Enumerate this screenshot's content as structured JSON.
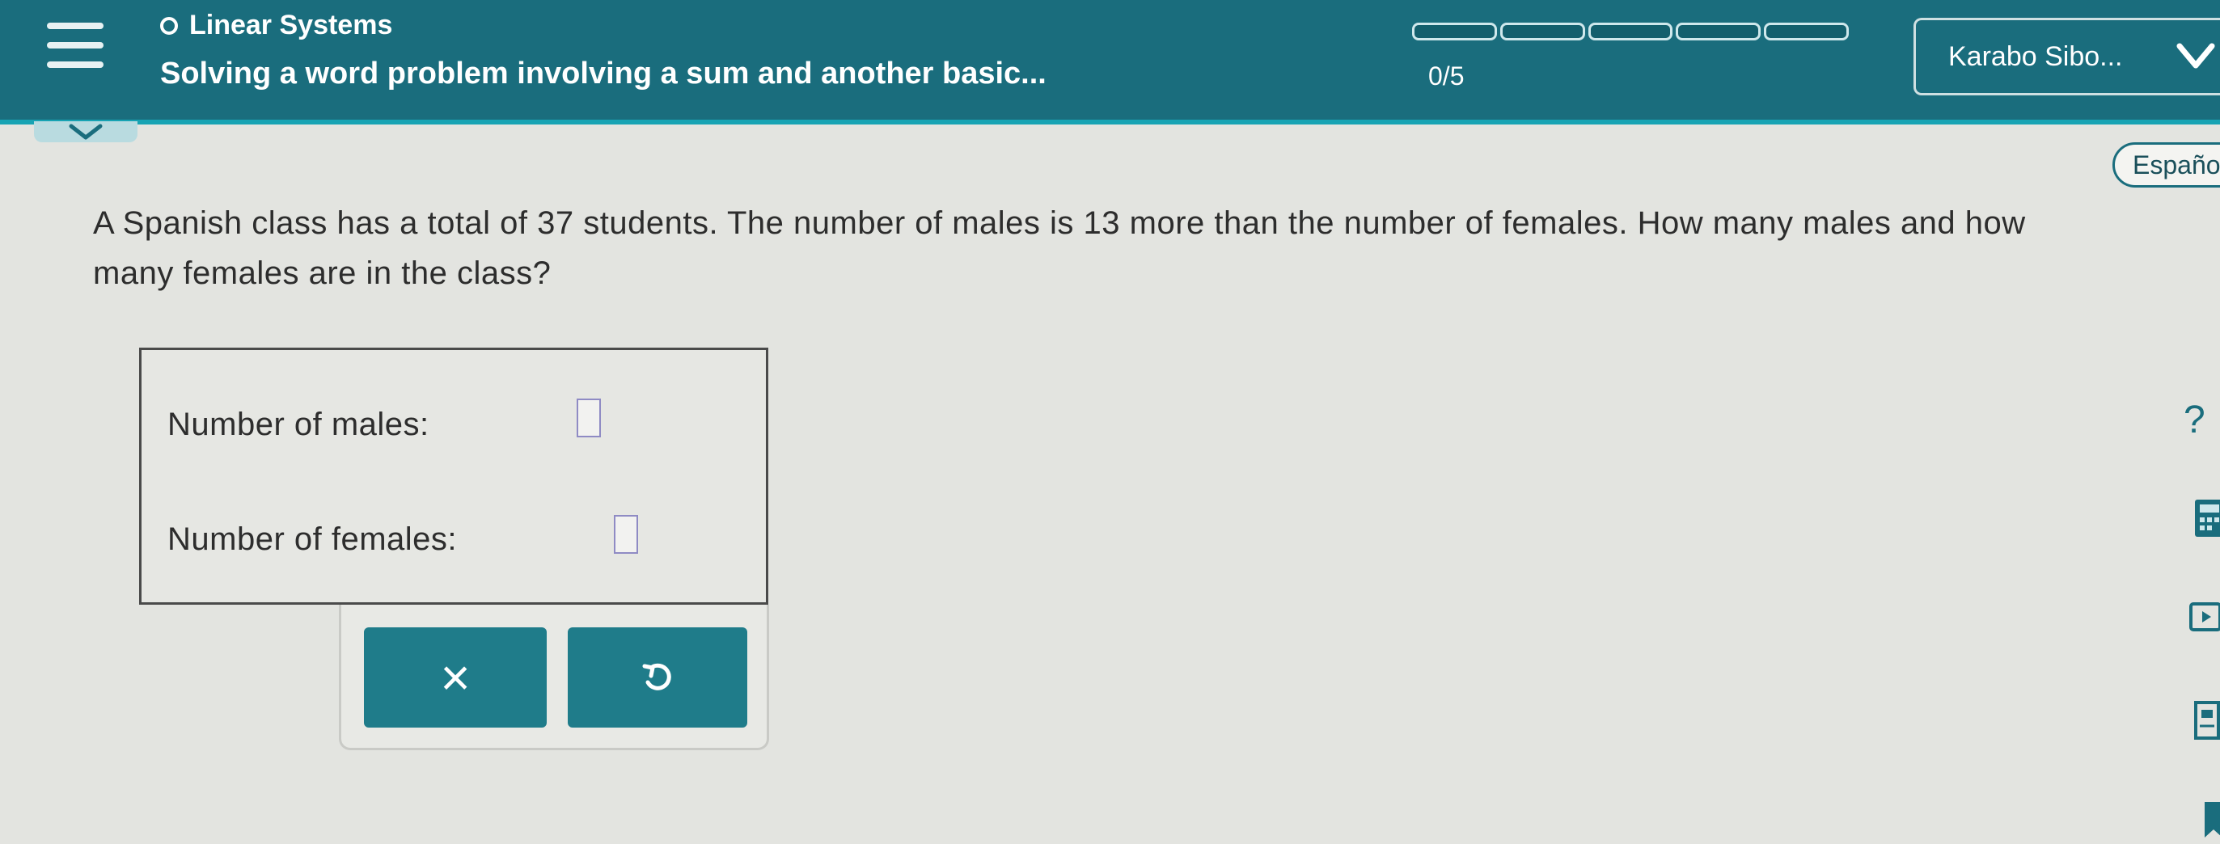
{
  "header": {
    "topic": "Linear Systems",
    "problem_title": "Solving a word problem involving a sum and another basic...",
    "progress_text": "0/5",
    "progress_fraction": 0,
    "progress_segments": 5,
    "user_name": "Karabo Sibo..."
  },
  "toolbar": {
    "language_label": "Españo"
  },
  "question": {
    "text": "A Spanish class has a total of 37 students. The number of males is 13 more than the number of females. How many males and how many females are in the class?"
  },
  "answers": {
    "males_label": "Number of males:",
    "males_value": "",
    "females_label": "Number of females:",
    "females_value": ""
  },
  "buttons": {
    "clear_symbol": "×"
  },
  "sidebar": {
    "help_symbol": "?"
  },
  "colors": {
    "header_bg": "#1a6d7d",
    "accent": "#17a3b3",
    "button_bg": "#1f7c8a",
    "input_border": "#8f8bc4"
  },
  "icons": [
    "menu-icon",
    "topic-circle-icon",
    "chevron-down-icon",
    "undo-icon",
    "clear-icon",
    "help-icon",
    "calculator-icon",
    "video-icon",
    "document-icon"
  ]
}
